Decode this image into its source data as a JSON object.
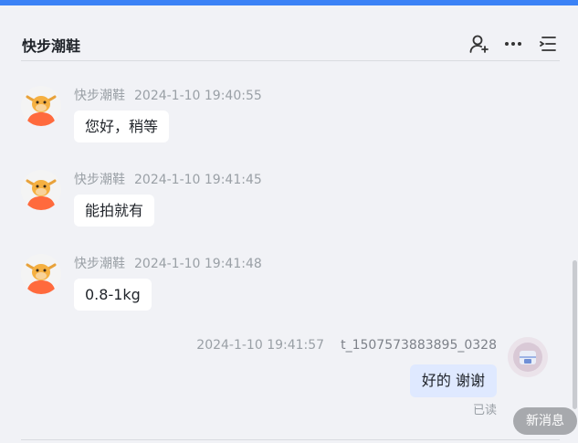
{
  "header": {
    "title": "快步潮鞋",
    "icons": [
      "add-member-icon",
      "more-icon",
      "menu-list-icon"
    ]
  },
  "messages": [
    {
      "sender": "快步潮鞋",
      "time": "2024-1-10 19:40:55",
      "text": "您好，稍等"
    },
    {
      "sender": "快步潮鞋",
      "time": "2024-1-10 19:41:45",
      "text": "能拍就有"
    },
    {
      "sender": "快步潮鞋",
      "time": "2024-1-10 19:41:48",
      "text": "0.8-1kg"
    }
  ],
  "self_message": {
    "time": "2024-1-10 19:41:57",
    "sender": "t_1507573883895_0328",
    "text": "好的 谢谢",
    "status": "已读"
  },
  "new_message_button": {
    "label": "新消息"
  },
  "colors": {
    "accent": "#3b82f6",
    "self_bubble": "#dfe9ff",
    "background": "#f1f2f6"
  }
}
